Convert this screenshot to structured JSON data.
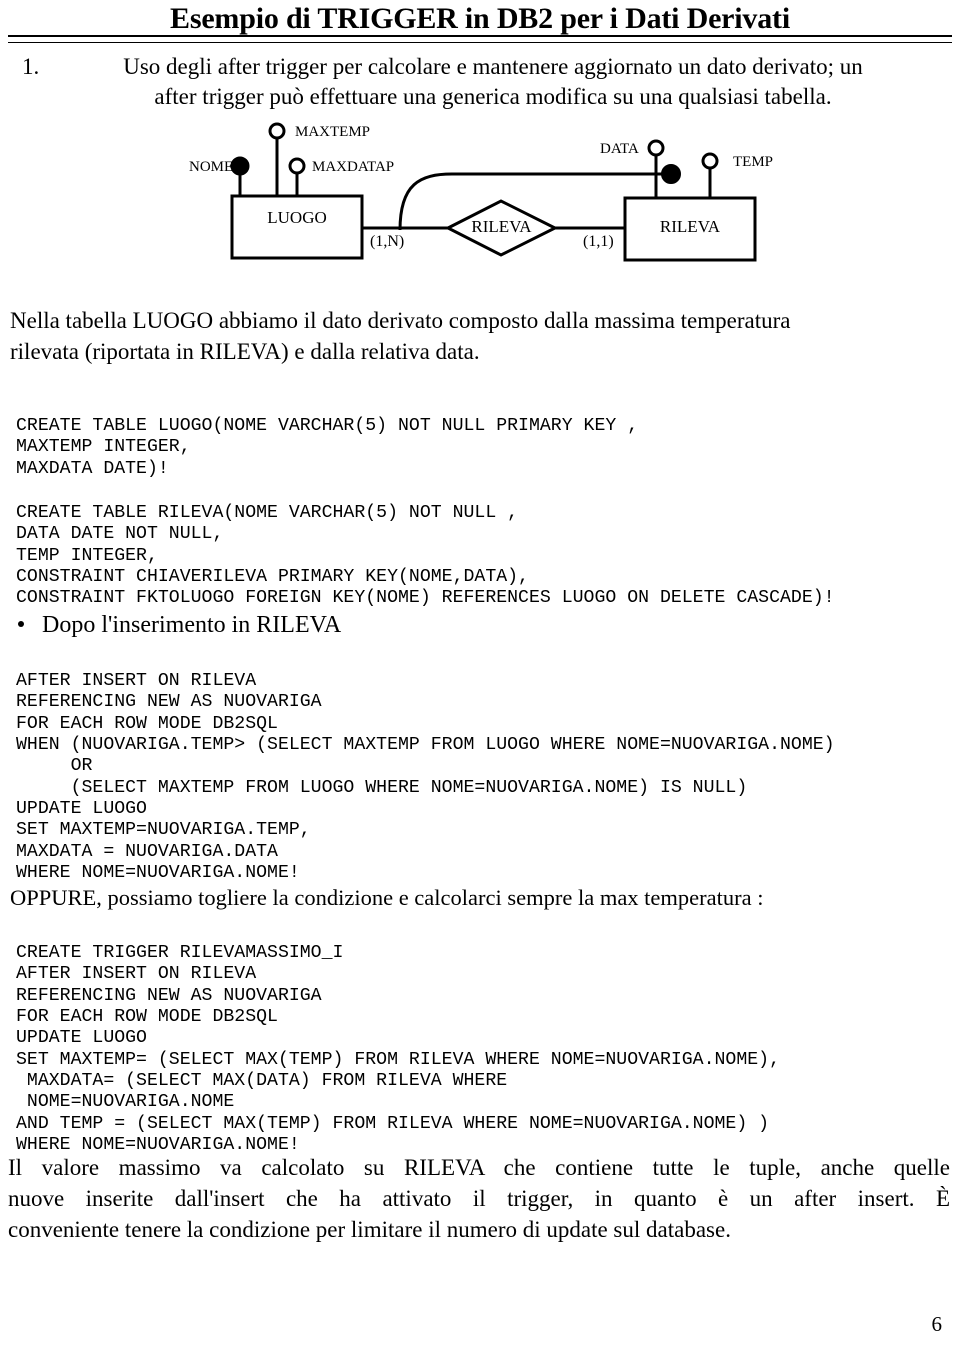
{
  "document": {
    "title": "Esempio di TRIGGER in DB2 per i Dati Derivati",
    "page_number": "6"
  },
  "intro": {
    "number": "1.",
    "line1": "Uso degli after trigger per calcolare e mantenere aggiornato un dato derivato; un",
    "line2": "after trigger può effettuare una generica modifica su una qualsiasi tabella."
  },
  "er_diagram": {
    "entities": [
      {
        "name": "LUOGO"
      },
      {
        "name": "RILEVA"
      }
    ],
    "relationship": {
      "name": "RILEVA"
    },
    "attributes": [
      {
        "label": "NOME",
        "key": true
      },
      {
        "label": "MAXTEMP",
        "key": false
      },
      {
        "label": "MAXDATAP",
        "key": false
      },
      {
        "label": "DATA",
        "key": true
      },
      {
        "label": "TEMP",
        "key": false
      }
    ],
    "cardinalities": [
      {
        "label": "(1,N)"
      },
      {
        "label": "(1,1)"
      }
    ]
  },
  "paragraph_derivato": {
    "line1": "Nella tabella LUOGO abbiamo il dato derivato composto dalla massima temperatura",
    "line2": "rilevata (riportata in RILEVA) e dalla relativa data."
  },
  "code_create_luogo": "CREATE TABLE LUOGO(NOME VARCHAR(5) NOT NULL PRIMARY KEY ,\nMAXTEMP INTEGER,\nMAXDATA DATE)!",
  "code_create_rileva": "CREATE TABLE RILEVA(NOME VARCHAR(5) NOT NULL ,\nDATA DATE NOT NULL,\nTEMP INTEGER,\nCONSTRAINT CHIAVERILEVA PRIMARY KEY(NOME,DATA),\nCONSTRAINT FKTOLUOGO FOREIGN KEY(NOME) REFERENCES LUOGO ON DELETE CASCADE)!",
  "bullet_heading": "Dopo l'inserimento in RILEVA",
  "code_trigger_condizionale": "AFTER INSERT ON RILEVA\nREFERENCING NEW AS NUOVARIGA\nFOR EACH ROW MODE DB2SQL\nWHEN (NUOVARIGA.TEMP> (SELECT MAXTEMP FROM LUOGO WHERE NOME=NUOVARIGA.NOME)\n     OR\n     (SELECT MAXTEMP FROM LUOGO WHERE NOME=NUOVARIGA.NOME) IS NULL)\nUPDATE LUOGO\nSET MAXTEMP=NUOVARIGA.TEMP,\nMAXDATA = NUOVARIGA.DATA\nWHERE NOME=NUOVARIGA.NOME!",
  "paragraph_oppure": "OPPURE, possiamo togliere la condizione e calcolarci sempre la max temperatura :",
  "code_trigger_massimo": "CREATE TRIGGER RILEVAMASSIMO_I\nAFTER INSERT ON RILEVA\nREFERENCING NEW AS NUOVARIGA\nFOR EACH ROW MODE DB2SQL\nUPDATE LUOGO\nSET MAXTEMP= (SELECT MAX(TEMP) FROM RILEVA WHERE NOME=NUOVARIGA.NOME),\n MAXDATA= (SELECT MAX(DATA) FROM RILEVA WHERE\n NOME=NUOVARIGA.NOME\nAND TEMP = (SELECT MAX(TEMP) FROM RILEVA WHERE NOME=NUOVARIGA.NOME) )\nWHERE NOME=NUOVARIGA.NOME!",
  "paragraph_conclusione": {
    "line1": "Il valore massimo va calcolato su RILEVA che contiene tutte le tuple, anche quelle",
    "line2": "nuove inserite dall'insert che ha attivato il trigger, in quanto è un after insert. È",
    "line3": "conveniente tenere la condizione per limitare il numero di update sul database."
  }
}
